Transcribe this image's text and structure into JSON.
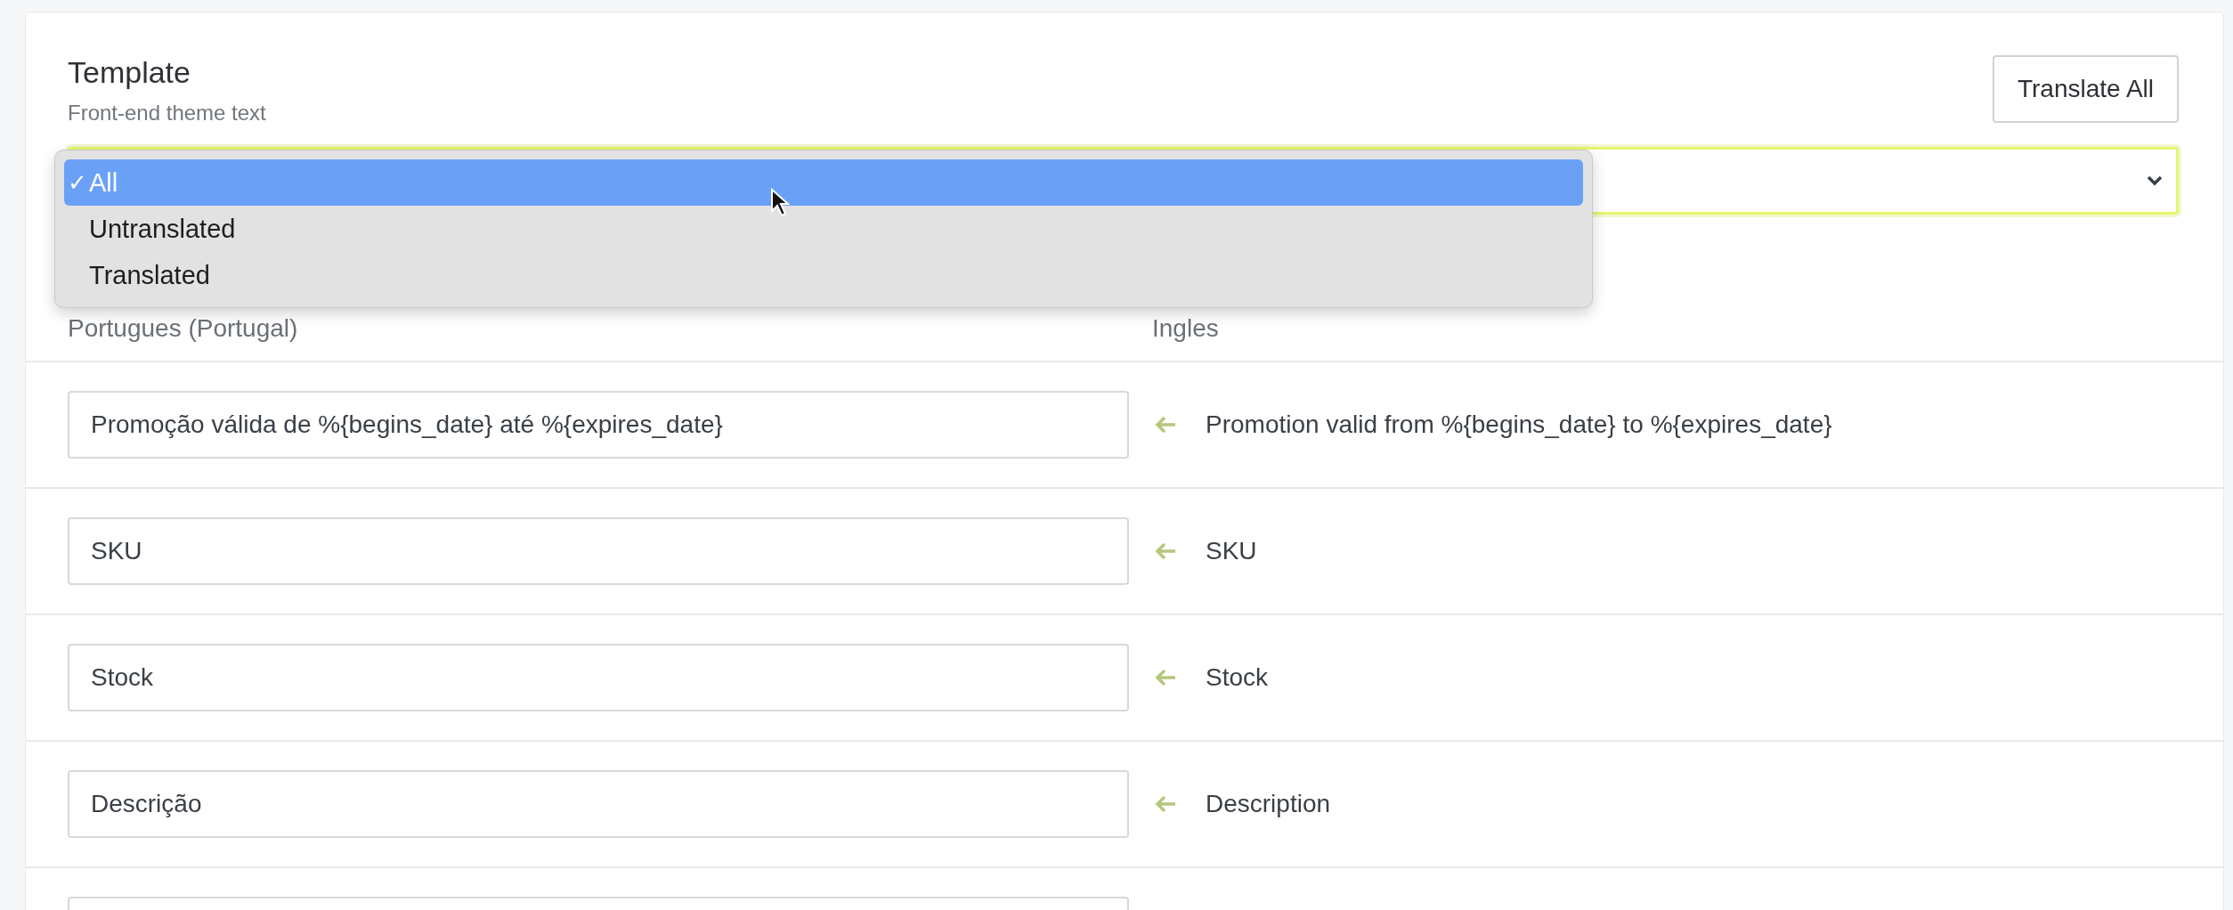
{
  "header": {
    "title": "Template",
    "subtitle": "Front-end theme text"
  },
  "translate_button": "Translate All",
  "filter_menu": [
    {
      "label": "All",
      "check": "✓",
      "selected": true
    },
    {
      "label": "Untranslated",
      "selected": false
    },
    {
      "label": "Translated",
      "selected": false
    }
  ],
  "columns": [
    "Portugues (Portugal)",
    "Ingles"
  ],
  "rows": [
    {
      "translation": "Promoção válida de %{begins_date} até %{expires_date}",
      "source": "Promotion valid from %{begins_date} to %{expires_date}"
    },
    {
      "translation": "SKU",
      "source": "SKU"
    },
    {
      "translation": "Stock",
      "source": "Stock"
    },
    {
      "translation": "Descrição",
      "source": "Description"
    }
  ]
}
